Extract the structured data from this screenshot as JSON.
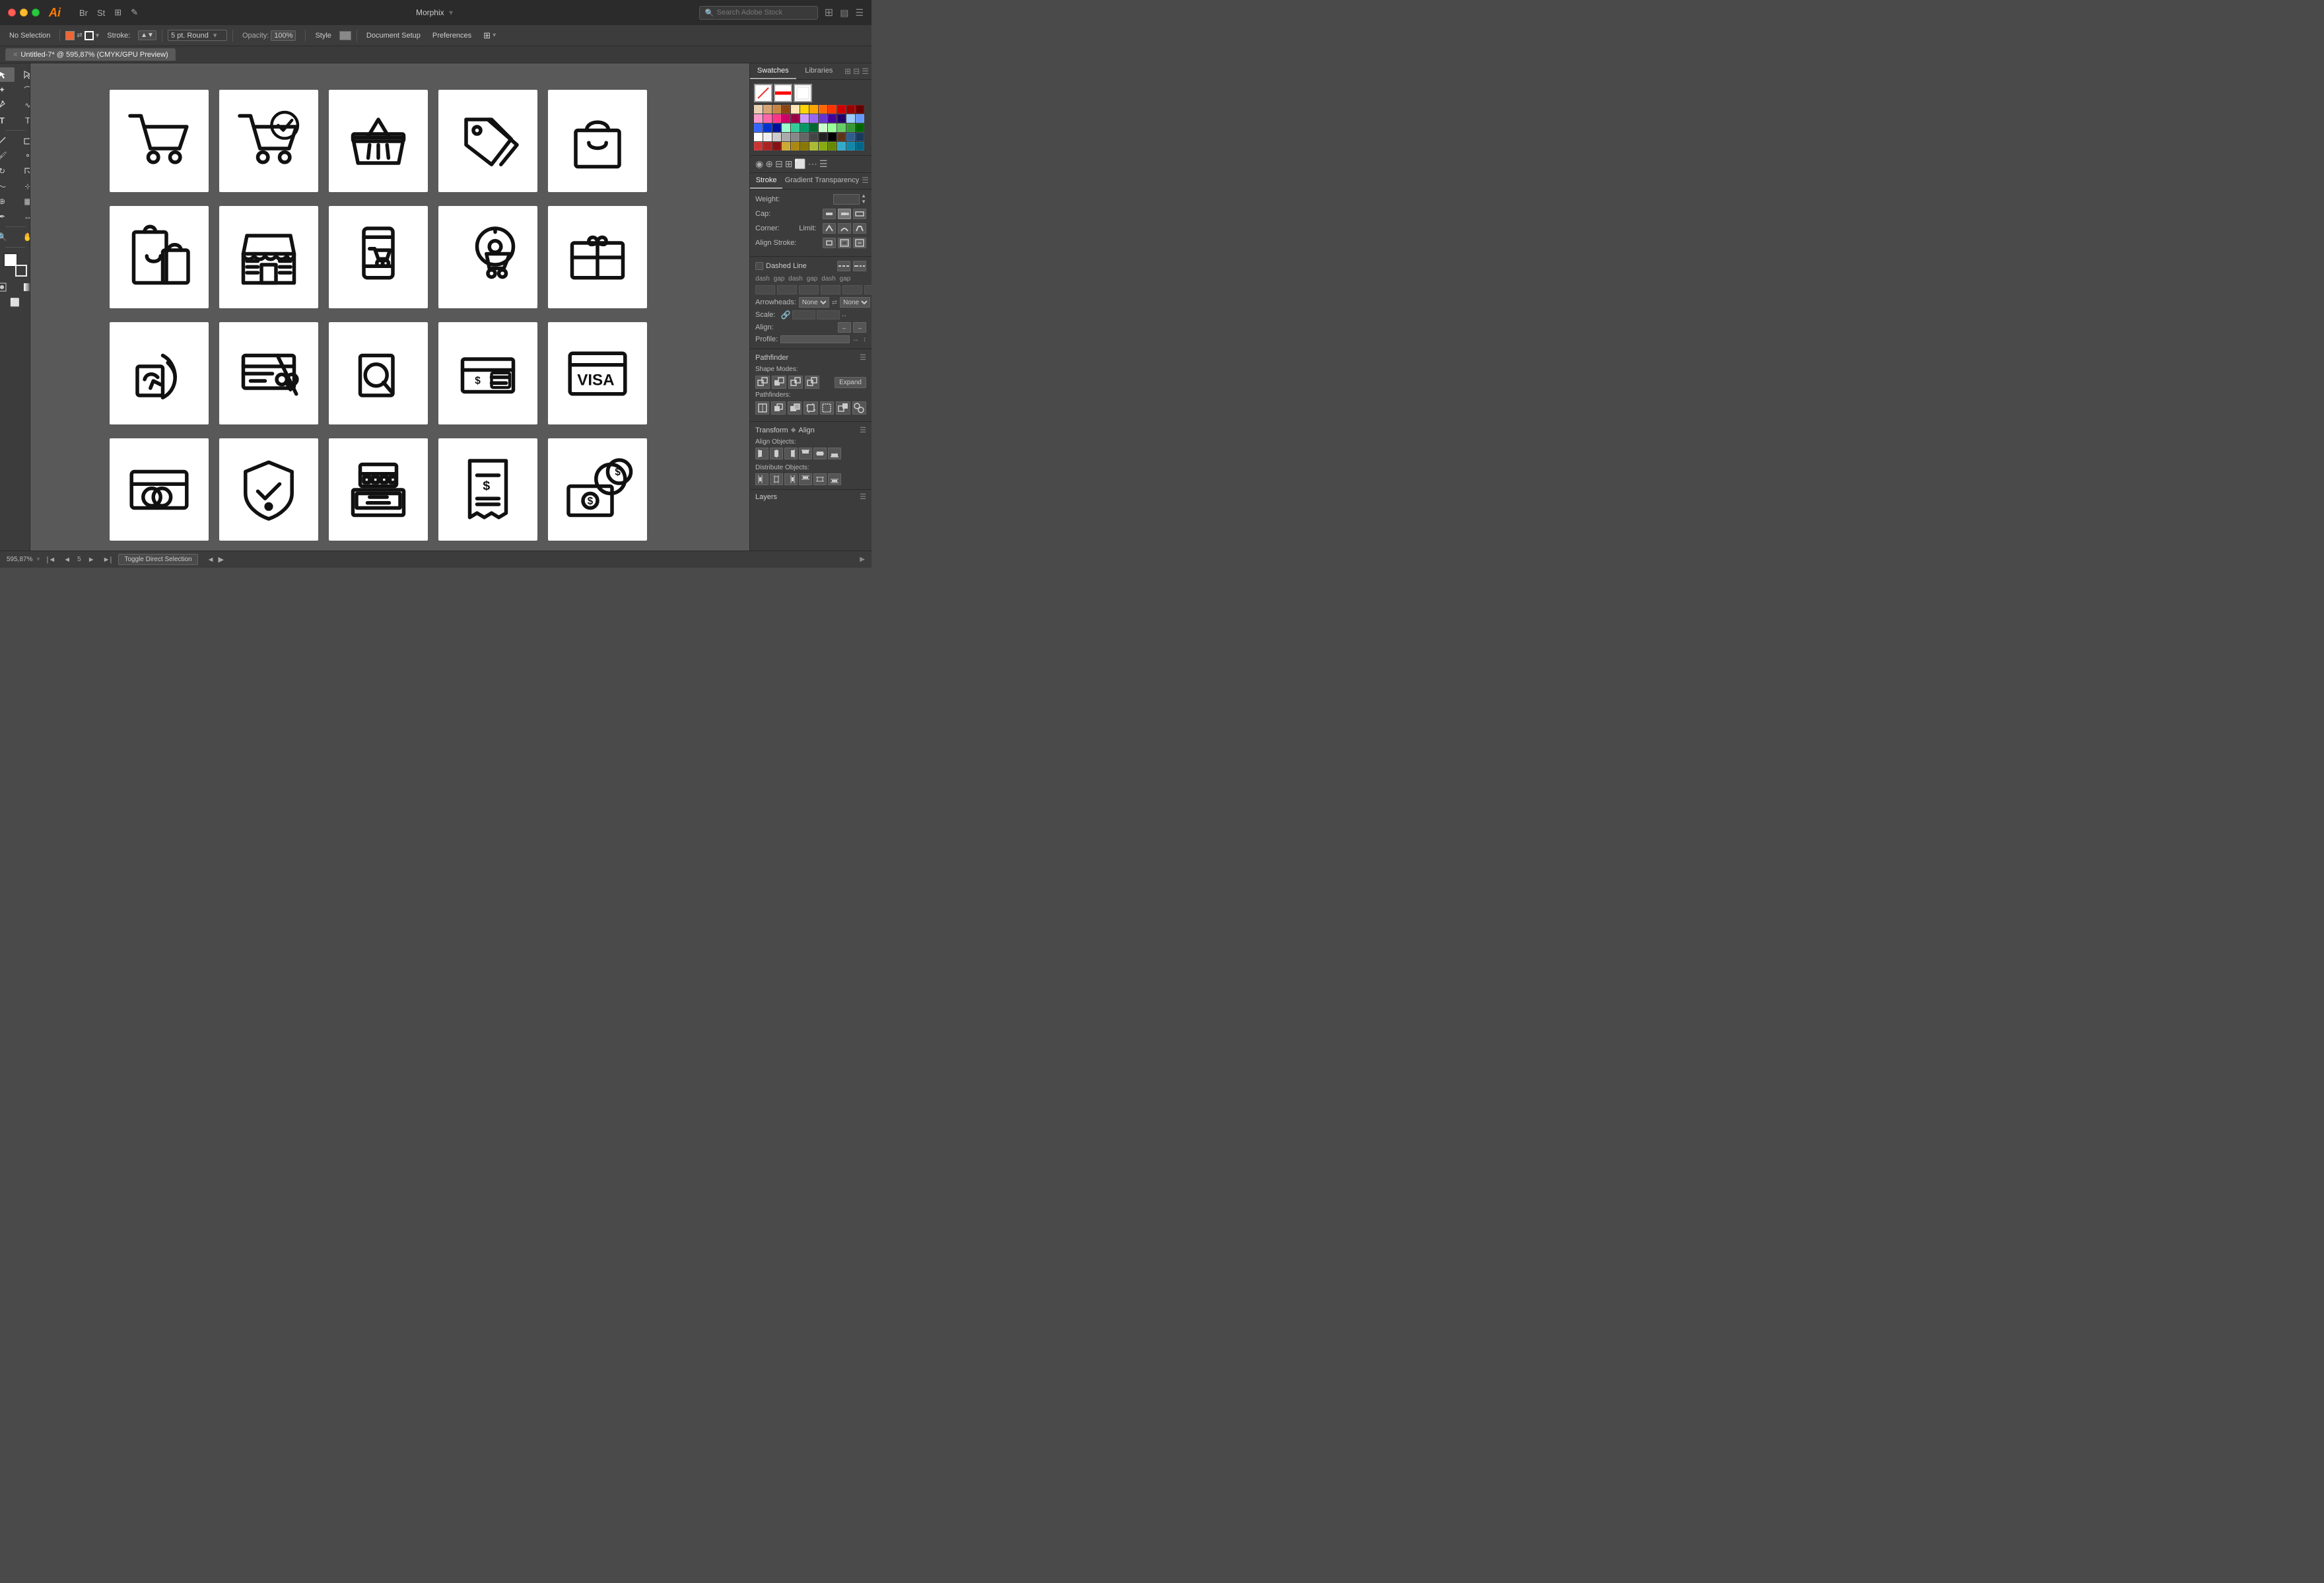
{
  "app": {
    "name": "Morphix",
    "logo": "Ai",
    "tab_title": "Untitled-7* @ 595,87% (CMYK/GPU Preview)"
  },
  "titlebar": {
    "traffic_lights": [
      "red",
      "yellow",
      "green"
    ],
    "app_icons": [
      "br",
      "st",
      "grid",
      "arrow"
    ],
    "search_placeholder": "Search Adobe Stock",
    "search_label": "Search Adobe Stock",
    "morphix_label": "Morphix"
  },
  "toolbar": {
    "no_selection": "No Selection",
    "stroke_label": "Stroke:",
    "pt_round": "5 pt. Round",
    "opacity_label": "Opacity:",
    "opacity_value": "100%",
    "style_label": "Style",
    "doc_setup": "Document Setup",
    "preferences": "Preferences"
  },
  "status_bar": {
    "zoom": "595,87%",
    "artboard_prev": "◄",
    "artboard_num": "5",
    "artboard_next": "►",
    "artboard_end": "►|",
    "toggle_direct": "Toggle Direct Selection"
  },
  "panels": {
    "swatches_tab": "Swatches",
    "libraries_tab": "Libraries",
    "stroke_tab": "Stroke",
    "gradient_tab": "Gradient",
    "transparency_tab": "Transparency",
    "weight_label": "Weight:",
    "cap_label": "Cap:",
    "corner_label": "Corner:",
    "limit_label": "Limit:",
    "align_stroke_label": "Align Stroke:",
    "dashed_line_label": "Dashed Line",
    "dash_labels": [
      "dash",
      "gap",
      "dash",
      "gap",
      "dash",
      "gap"
    ],
    "arrowheads_label": "Arrowheads:",
    "scale_label": "Scale:",
    "align_label": "Align:",
    "profile_label": "Profile:",
    "pathfinder_label": "Pathfinder",
    "shape_modes_label": "Shape Modes:",
    "expand_label": "Expand",
    "pathfinders_label": "Pathfinders:",
    "transform_label": "Transform",
    "align_label2": "Align",
    "align_objects_label": "Align Objects:",
    "distribute_objects_label": "Distribute Objects:",
    "layers_label": "Layers"
  },
  "icons": [
    {
      "id": "cart",
      "label": "Shopping Cart"
    },
    {
      "id": "cart-check",
      "label": "Cart with Checkmark"
    },
    {
      "id": "basket",
      "label": "Shopping Basket"
    },
    {
      "id": "price-tag",
      "label": "Price Tag"
    },
    {
      "id": "shopping-bag",
      "label": "Shopping Bag"
    },
    {
      "id": "bag-return",
      "label": "Bag Return"
    },
    {
      "id": "store",
      "label": "Store Front"
    },
    {
      "id": "mobile-cart",
      "label": "Mobile Cart"
    },
    {
      "id": "cart-location",
      "label": "Cart Location"
    },
    {
      "id": "gift-card",
      "label": "Gift Card"
    },
    {
      "id": "contactless-pay",
      "label": "Contactless Payment"
    },
    {
      "id": "credit-cut",
      "label": "Credit Card Cut"
    },
    {
      "id": "search-pay",
      "label": "Search Payment"
    },
    {
      "id": "card-payment",
      "label": "Card Payment"
    },
    {
      "id": "visa",
      "label": "VISA Card"
    },
    {
      "id": "debit-card",
      "label": "Debit Card"
    },
    {
      "id": "shield-check",
      "label": "Shield Check"
    },
    {
      "id": "cash-register",
      "label": "Cash Register"
    },
    {
      "id": "receipt",
      "label": "Receipt"
    },
    {
      "id": "money-coins",
      "label": "Money and Coins"
    }
  ]
}
